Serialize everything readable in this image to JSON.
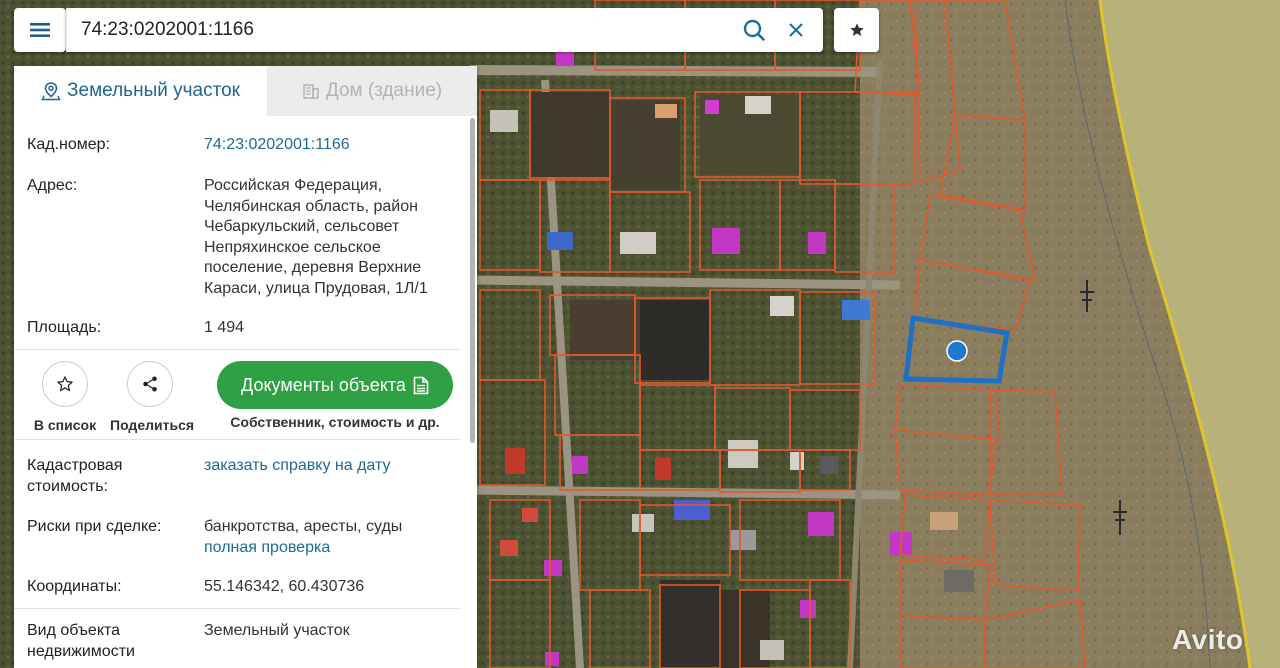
{
  "search": {
    "value": "74:23:0202001:1166",
    "menu_icon": "hamburger-menu-icon",
    "search_icon": "search-icon",
    "clear_icon": "close-icon",
    "favorite_icon": "star-filled-icon"
  },
  "tabs": [
    {
      "label": "Земельный участок",
      "icon": "land-plot-icon",
      "active": true
    },
    {
      "label": "Дом (здание)",
      "icon": "building-icon",
      "active": false
    }
  ],
  "details_top": [
    {
      "label": "Кад.номер:",
      "value": "74:23:0202001:1166",
      "is_link": true
    },
    {
      "label": "Адрес:",
      "value": "Российская Федерация, Челябинская область, район Чебаркульский, сельсовет Непряхинское сельское поселение, деревня Верхние Караси, улица Прудовая, 1Л/1"
    },
    {
      "label": "Площадь:",
      "value": "1 494"
    }
  ],
  "actions": {
    "add_to_list": "В список",
    "share": "Поделиться",
    "documents_button": "Документы объекта",
    "documents_subtitle": "Собственник, стоимость и др."
  },
  "details_bottom": {
    "cadastral_cost_label": "Кадастровая стоимость:",
    "cadastral_cost_link": "заказать справку на дату",
    "risks_label": "Риски при сделке:",
    "risks_value": "банкротства, аресты, суды",
    "risks_link": "полная проверка",
    "coords_label": "Координаты:",
    "coords_value": "55.146342, 60.430736",
    "type_label": "Вид объекта недвижимости",
    "type_value": "Земельный участок"
  },
  "watermark": "Avito",
  "colors": {
    "accent_blue": "#1c6a96",
    "button_green": "#2fa043",
    "parcel_outline": "#e2582f",
    "selected_parcel": "#1f6fc4",
    "marker": "#1f78d1"
  }
}
